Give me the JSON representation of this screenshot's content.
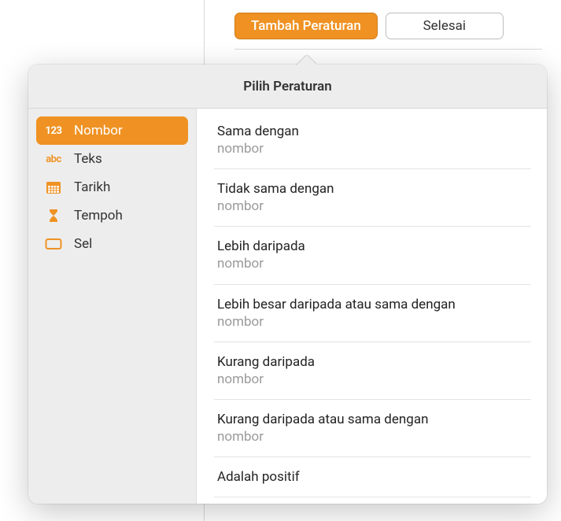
{
  "header": {
    "add_rule_label": "Tambah Peraturan",
    "done_label": "Selesai"
  },
  "popover": {
    "title": "Pilih Peraturan"
  },
  "sidebar": {
    "items": [
      {
        "label": "Nombor",
        "selected": true
      },
      {
        "label": "Teks",
        "selected": false
      },
      {
        "label": "Tarikh",
        "selected": false
      },
      {
        "label": "Tempoh",
        "selected": false
      },
      {
        "label": "Sel",
        "selected": false
      }
    ]
  },
  "rules": [
    {
      "title": "Sama dengan",
      "sub": "nombor"
    },
    {
      "title": "Tidak sama dengan",
      "sub": "nombor"
    },
    {
      "title": "Lebih daripada",
      "sub": "nombor"
    },
    {
      "title": "Lebih besar daripada atau sama dengan",
      "sub": "nombor"
    },
    {
      "title": "Kurang daripada",
      "sub": "nombor"
    },
    {
      "title": "Kurang daripada atau sama dengan",
      "sub": "nombor"
    },
    {
      "title": "Adalah positif",
      "sub": ""
    }
  ]
}
